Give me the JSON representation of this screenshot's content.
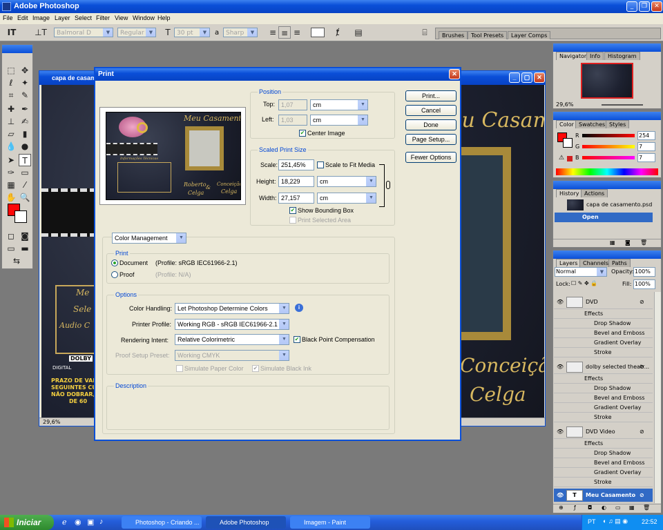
{
  "app": {
    "title": "Adobe Photoshop"
  },
  "menu": [
    "File",
    "Edit",
    "Image",
    "Layer",
    "Select",
    "Filter",
    "View",
    "Window",
    "Help"
  ],
  "options": {
    "font_family": "Balmoral D",
    "font_style": "Regular",
    "font_size": "30 pt",
    "aa_label": "a",
    "aa_value": "Sharp",
    "wells": [
      "Brushes",
      "Tool Presets",
      "Layer Comps"
    ]
  },
  "doc": {
    "title": "capa de casamento.psd",
    "zoom": "29,6%",
    "script_top": "Meu Casamento",
    "script_mid_1": "Conceição",
    "script_mid_2": "Celga",
    "left_1": "Me",
    "left_2": "Sele",
    "left_3": "Audio C",
    "dolby": "DOLBY",
    "digital": "DIGITAL",
    "warn_1": "PRAZO DE VALIDADE",
    "warn_2": "SEGUINTES CUIDADO",
    "warn_3": "NÃO DOBRAR, NÃO E",
    "warn_4": "DE 60"
  },
  "dialog": {
    "title": "Print",
    "preview": {
      "title": "Meu Casamento",
      "names_1": "Roberto",
      "names_amp": "&",
      "names_2": "Conceição",
      "names_3": "Celga",
      "names_4": "Celga",
      "tech": "Informações Técnicas"
    },
    "position": {
      "label": "Position",
      "top_label": "Top:",
      "top_value": "1,07",
      "top_unit": "cm",
      "left_label": "Left:",
      "left_value": "1,03",
      "left_unit": "cm",
      "center_label": "Center Image"
    },
    "scaled": {
      "label": "Scaled Print Size",
      "scale_label": "Scale:",
      "scale_value": "251,45%",
      "fit_label": "Scale to Fit Media",
      "height_label": "Height:",
      "height_value": "18,229",
      "height_unit": "cm",
      "width_label": "Width:",
      "width_value": "27,157",
      "width_unit": "cm",
      "bbox_label": "Show Bounding Box",
      "selected_label": "Print Selected Area"
    },
    "buttons": {
      "print": "Print...",
      "cancel": "Cancel",
      "done": "Done",
      "page_setup": "Page Setup...",
      "fewer": "Fewer Options"
    },
    "mode": "Color Management",
    "print_group": {
      "label": "Print",
      "doc_label": "Document",
      "doc_profile": "(Profile: sRGB IEC61966-2.1)",
      "proof_label": "Proof",
      "proof_profile": "(Profile: N/A)"
    },
    "options_group": {
      "label": "Options",
      "handling_label": "Color Handling:",
      "handling_value": "Let Photoshop Determine Colors",
      "profile_label": "Printer Profile:",
      "profile_value": "Working RGB - sRGB IEC61966-2.1",
      "intent_label": "Rendering Intent:",
      "intent_value": "Relative Colorimetric",
      "bpc_label": "Black Point Compensation",
      "proof_label": "Proof Setup Preset:",
      "proof_value": "Working CMYK",
      "paper_label": "Simulate Paper Color",
      "ink_label": "Simulate Black Ink"
    },
    "description_label": "Description"
  },
  "navigator": {
    "tabs": [
      "Navigator",
      "Info",
      "Histogram"
    ],
    "zoom": "29,6%"
  },
  "color": {
    "tabs": [
      "Color",
      "Swatches",
      "Styles"
    ],
    "r_label": "R",
    "r": "254",
    "g_label": "G",
    "g": "7",
    "b_label": "B",
    "b": "7",
    "fg": "#fe0707"
  },
  "history": {
    "tabs": [
      "History",
      "Actions"
    ],
    "items": [
      "capa de casamento.psd",
      "Open"
    ]
  },
  "layers": {
    "tabs": [
      "Layers",
      "Channels",
      "Paths"
    ],
    "blend": "Normal",
    "opacity_label": "Opacity:",
    "opacity": "100%",
    "lock_label": "Lock:",
    "fill_label": "Fill:",
    "fill": "100%",
    "rows": [
      "DVD",
      "Effects",
      "Drop Shadow",
      "Bevel and Emboss",
      "Gradient Overlay",
      "Stroke",
      "dolby selected theatr...",
      "Effects",
      "Drop Shadow",
      "Bevel and Emboss",
      "Gradient Overlay",
      "Stroke",
      "DVD Video",
      "Effects",
      "Drop Shadow",
      "Bevel and Emboss",
      "Gradient Overlay",
      "Stroke",
      "Meu Casamento"
    ]
  },
  "taskbar": {
    "start": "Iniciar",
    "tasks": [
      "Photoshop - Criando ...",
      "Adobe Photoshop",
      "Imagem - Paint"
    ],
    "lang": "PT",
    "time": "22:52"
  }
}
